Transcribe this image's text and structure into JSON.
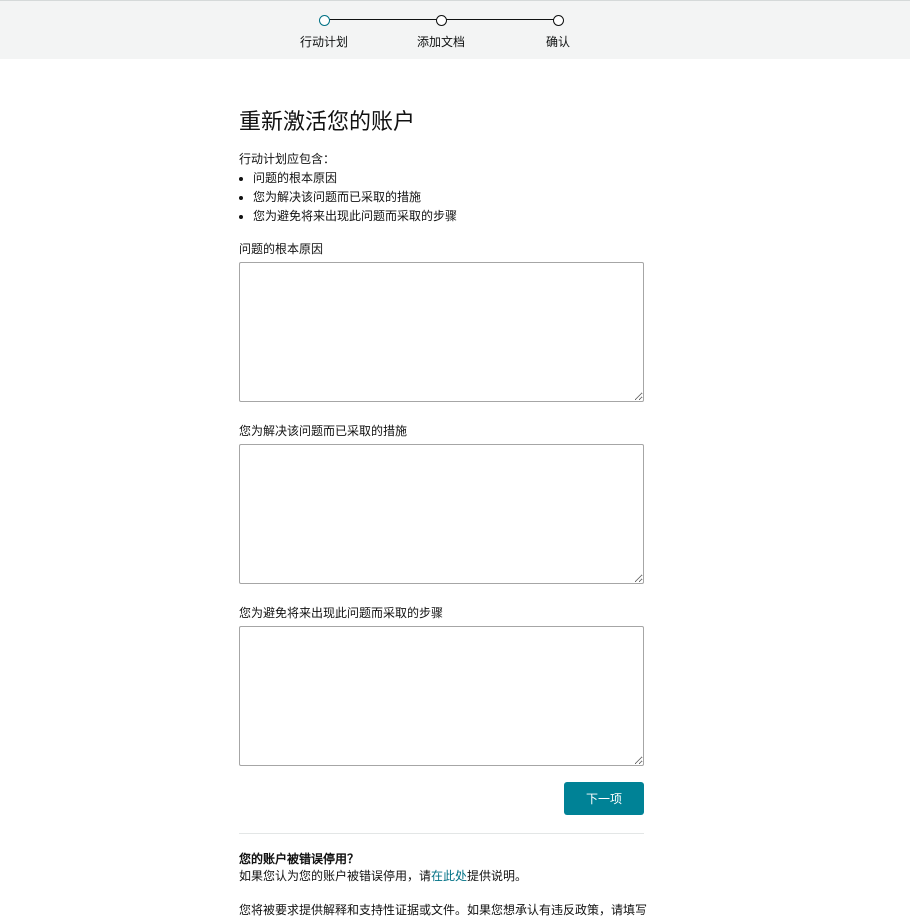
{
  "stepper": {
    "steps": [
      {
        "label": "行动计划",
        "active": true
      },
      {
        "label": "添加文档",
        "active": false
      },
      {
        "label": "确认",
        "active": false
      }
    ]
  },
  "main": {
    "title": "重新激活您的账户",
    "intro": "行动计划应包含：",
    "requirements": [
      "问题的根本原因",
      "您为解决该问题而已采取的措施",
      "您为避免将来出现此问题而采取的步骤"
    ],
    "fields": [
      {
        "label": "问题的根本原因",
        "value": ""
      },
      {
        "label": "您为解决该问题而已采取的措施",
        "value": ""
      },
      {
        "label": "您为避免将来出现此问题而采取的步骤",
        "value": ""
      }
    ],
    "next_label": "下一项"
  },
  "wrongly_deactivated": {
    "title": "您的账户被错误停用？",
    "text_before": "如果您认为您的账户被错误停用，请",
    "link": "在此处",
    "text_after": "提供说明。",
    "cut_text": "您将被要求提供解释和支持性证据或文件。如果您想承认有违反政策，请填写"
  },
  "colors": {
    "accent": "#008296",
    "link": "#007185",
    "topbar_bg": "#f3f4f4"
  }
}
